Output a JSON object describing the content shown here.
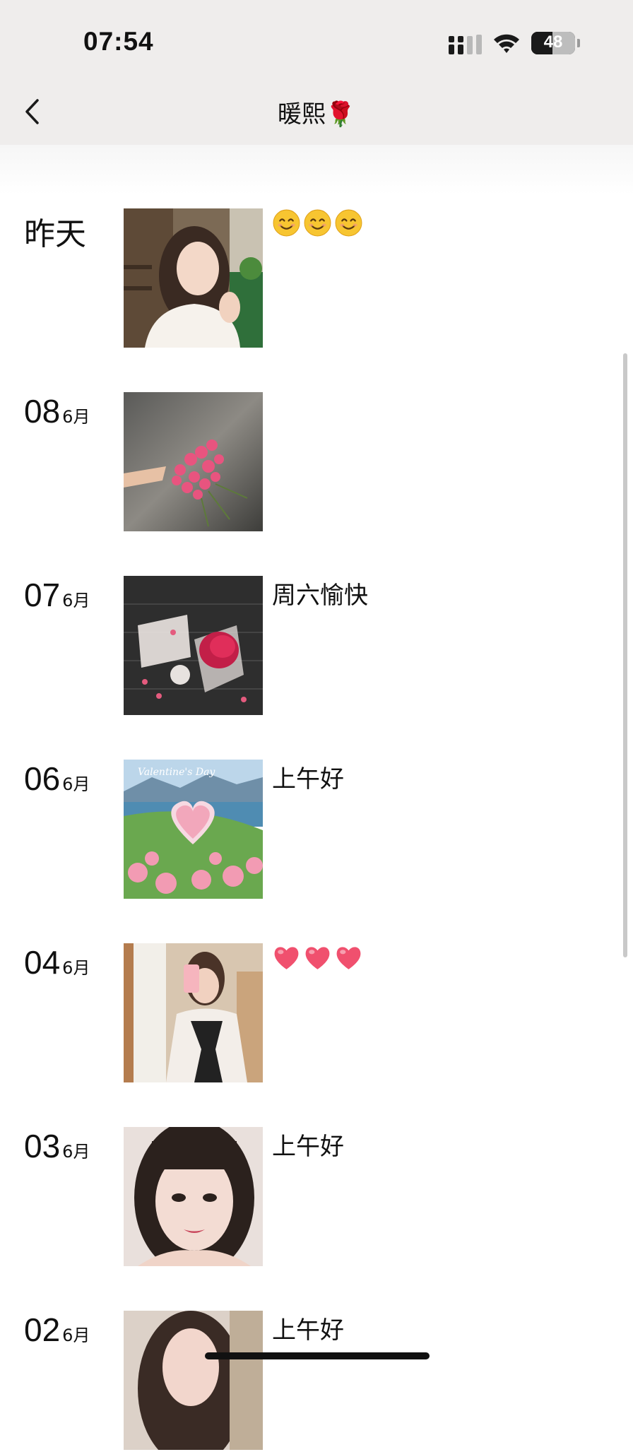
{
  "status": {
    "time": "07:54",
    "battery": "48",
    "battery_level": 0.48
  },
  "nav": {
    "title": "暖熙",
    "title_emoji": "🌹",
    "back_icon": "chevron-left-icon"
  },
  "posts": [
    {
      "date_text": "昨天",
      "caption": "",
      "emoji": [
        "smile",
        "smile",
        "smile"
      ],
      "photo": "girl-cafe"
    },
    {
      "day": "08",
      "month": "6月",
      "caption": "",
      "photo": "pink-flowers-wet-ground"
    },
    {
      "day": "07",
      "month": "6月",
      "caption": "周六愉快",
      "photo": "roses-gift-box"
    },
    {
      "day": "06",
      "month": "6月",
      "caption": "上午好",
      "photo": "valentines-heart-landscape",
      "photo_text": "Valentine's Day"
    },
    {
      "day": "04",
      "month": "6月",
      "caption": "",
      "emoji": [
        "heart",
        "heart",
        "heart"
      ],
      "photo": "mirror-selfie"
    },
    {
      "day": "03",
      "month": "6月",
      "caption": "上午好",
      "photo": "girl-portrait"
    },
    {
      "day": "02",
      "month": "6月",
      "caption": "上午好",
      "photo": "girl-portrait-2"
    }
  ],
  "colors": {
    "nav_bg": "#efedec",
    "heart": "#f0506e",
    "smile": "#f7c531"
  }
}
